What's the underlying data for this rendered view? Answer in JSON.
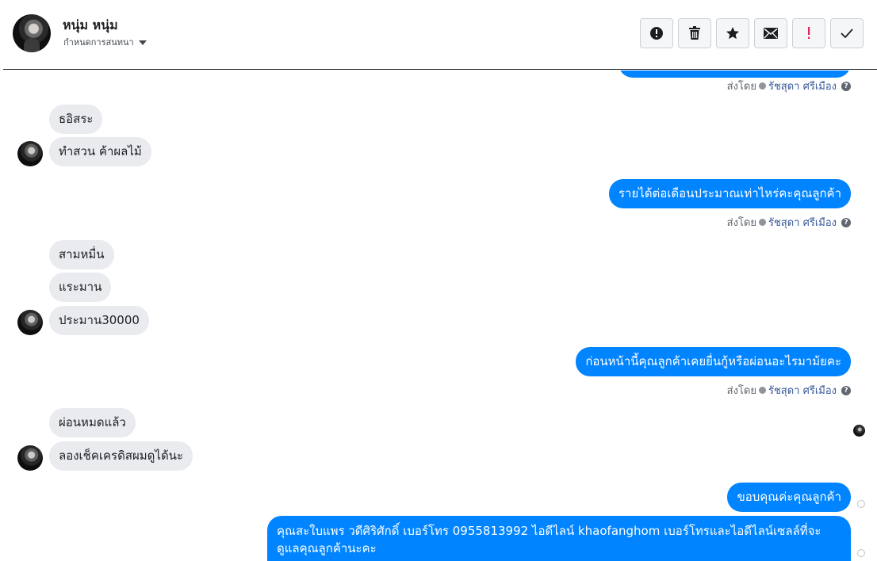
{
  "header": {
    "contact_name": "หนุ่ม หนุ่ม",
    "assign_label": "กำหนดการสนทนา",
    "toolbar": [
      {
        "icon": "alert-circle-icon",
        "name": "spam-button"
      },
      {
        "icon": "trash-icon",
        "name": "delete-button"
      },
      {
        "icon": "star-icon",
        "name": "star-button"
      },
      {
        "icon": "envelope-icon",
        "name": "mark-unread-button"
      },
      {
        "icon": "exclamation-icon",
        "name": "follow-up-button"
      },
      {
        "icon": "check-icon",
        "name": "done-button"
      }
    ]
  },
  "sent_by": {
    "prefix": "ส่งโดย",
    "agent": "รัชสุดา ศรีเมือง",
    "help": "?"
  },
  "messages": {
    "in_1": "ธอิสระ",
    "in_2": "ทำสวน ค้าผลไม้",
    "out_1": "รายได้ต่อเดือนประมาณเท่าไหร่คะคุณลูกค้า",
    "in_3": "สามหมื่น",
    "in_4": "แระมาน",
    "in_5": "ประมาน30000",
    "out_2": "ก่อนหน้านี้คุณลูกค้าเคยยื่นกู้หรือผ่อนอะไรมาม้ยคะ",
    "in_6": "ผ่อนหมดแล้ว",
    "in_7": "ลองเช็คเครดิสผมดูได้นะ",
    "out_3": "ขอบคุณค่ะคุณลูกค้า",
    "out_4": "คุณสะใบแพร วดีศิริศักดิ์ เบอร์โทร 0955813992 ไอดีไลน์ khaofanghom  เบอร์โทรและไอดีไลน์เซลล์ที่จะดูแลคุณลูกค้านะคะ"
  },
  "colors": {
    "outgoing": "#0084ff",
    "incoming": "#e9ebee",
    "agent_link": "#385898"
  }
}
